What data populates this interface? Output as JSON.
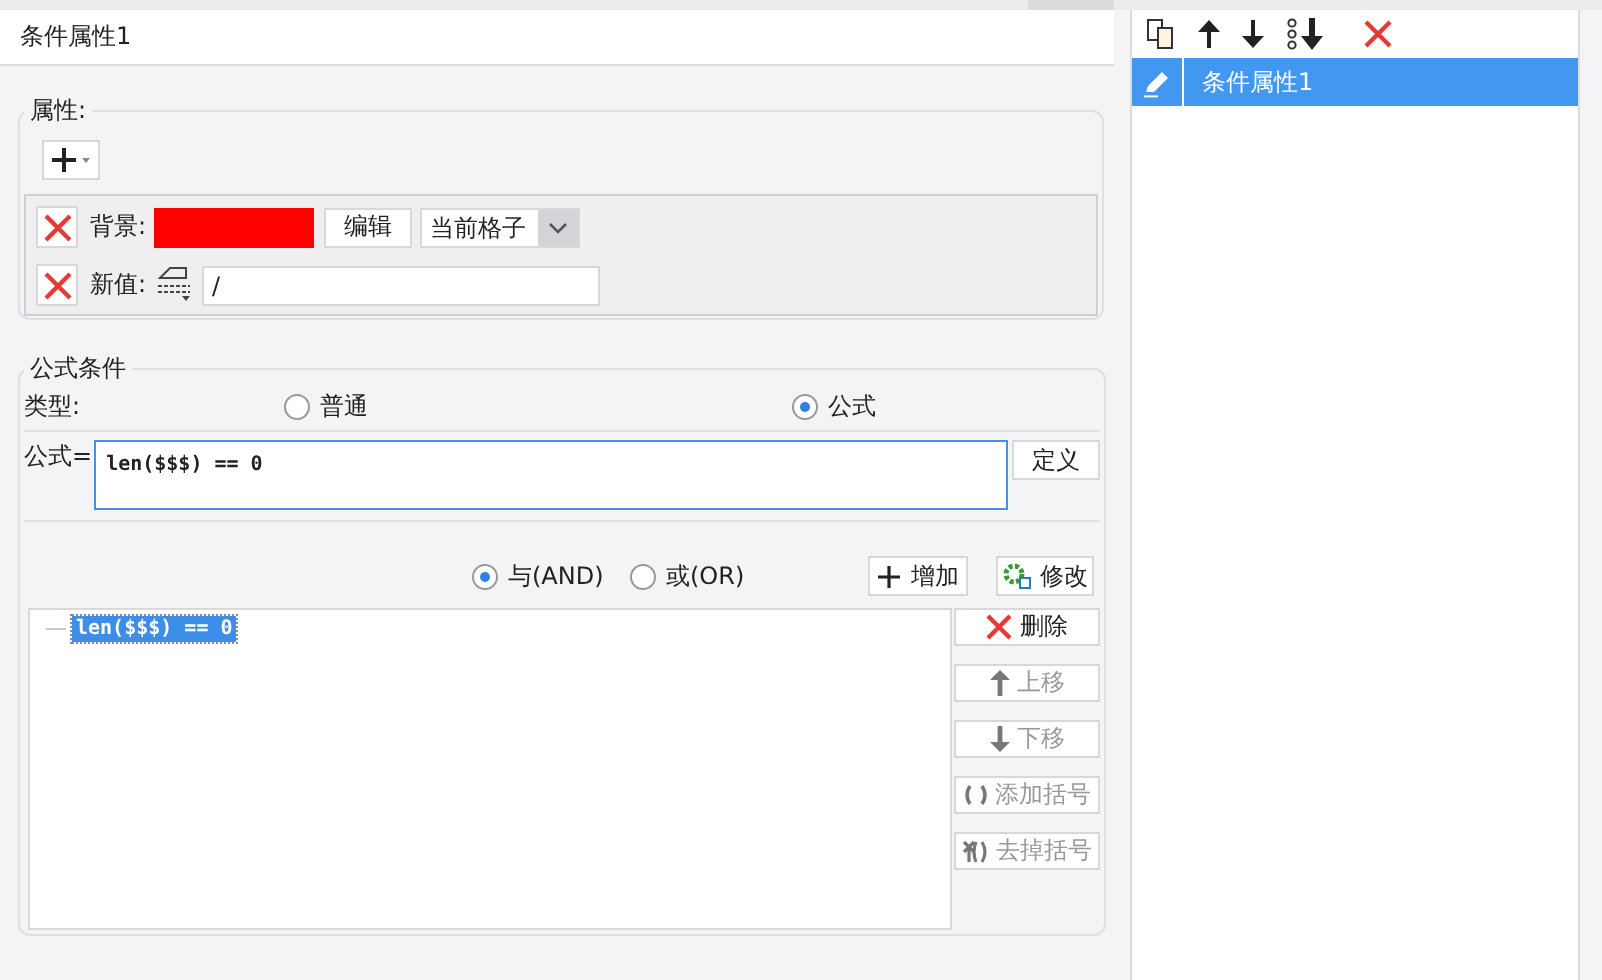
{
  "tab": {
    "label": "条件属性1"
  },
  "attributes": {
    "legend": "属性:",
    "items": [
      {
        "kind": "background",
        "label": "背景:",
        "color": "#ff0000",
        "edit_button": "编辑",
        "scope": "当前格子"
      },
      {
        "kind": "new_value",
        "label": "新值:",
        "value": "/"
      }
    ]
  },
  "formula_condition": {
    "legend": "公式条件",
    "type_label": "类型:",
    "types": [
      {
        "label": "普通",
        "selected": false
      },
      {
        "label": "公式",
        "selected": true
      }
    ],
    "formula_label": "公式=",
    "formula": "len($$$) == 0",
    "define_button": "定义",
    "logic": [
      {
        "label": "与(AND)",
        "selected": true
      },
      {
        "label": "或(OR)",
        "selected": false
      }
    ],
    "add_button": "增加",
    "modify_button": "修改",
    "conditions": [
      {
        "text": "len($$$) == 0",
        "selected": true
      }
    ],
    "actions": [
      {
        "kind": "delete",
        "label": "删除",
        "disabled": false
      },
      {
        "kind": "up",
        "label": "上移",
        "disabled": true
      },
      {
        "kind": "down",
        "label": "下移",
        "disabled": true
      },
      {
        "kind": "add_brackets",
        "label": "添加括号",
        "disabled": true
      },
      {
        "kind": "remove_brackets",
        "label": "去掉括号",
        "disabled": true
      }
    ]
  },
  "condition_list": {
    "items": [
      {
        "label": "条件属性1",
        "selected": true
      }
    ]
  }
}
